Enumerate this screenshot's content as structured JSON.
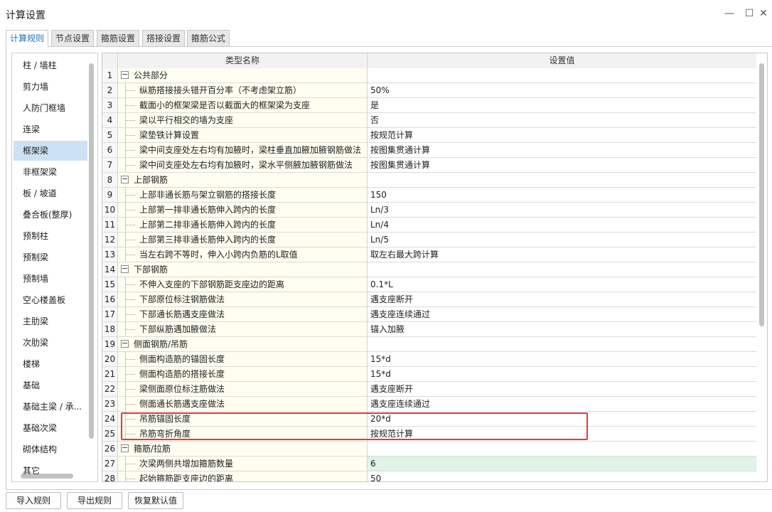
{
  "window": {
    "title": "计算设置",
    "minimize": "—",
    "maximize": "☐",
    "close": "✕"
  },
  "tabs": [
    "计算规则",
    "节点设置",
    "箍筋设置",
    "搭接设置",
    "箍筋公式"
  ],
  "sidebar": {
    "items": [
      "柱 / 墙柱",
      "剪力墙",
      "人防门框墙",
      "连梁",
      "框架梁",
      "非框架梁",
      "板 / 坡道",
      "叠合板(整厚)",
      "预制柱",
      "预制梁",
      "预制墙",
      "空心楼盖板",
      "主肋梁",
      "次肋梁",
      "楼梯",
      "基础",
      "基础主梁 / 承...",
      "基础次梁",
      "砌体结构",
      "其它"
    ],
    "selected_index": 4
  },
  "table": {
    "headers": {
      "name": "类型名称",
      "value": "设置值"
    },
    "rows": [
      {
        "num": "1",
        "group": true,
        "name": "公共部分",
        "value": ""
      },
      {
        "num": "2",
        "name": "纵筋搭接接头错开百分率（不考虑架立筋）",
        "value": "50%"
      },
      {
        "num": "3",
        "name": "截面小的框架梁是否以截面大的框架梁为支座",
        "value": "是"
      },
      {
        "num": "4",
        "name": "梁以平行相交的墙为支座",
        "value": "否"
      },
      {
        "num": "5",
        "name": "梁垫铁计算设置",
        "value": "按规范计算"
      },
      {
        "num": "6",
        "name": "梁中间支座处左右均有加腋时，梁柱垂直加腋加腋钢筋做法",
        "value": "按图集贯通计算"
      },
      {
        "num": "7",
        "name": "梁中间支座处左右均有加腋时，梁水平侧腋加腋钢筋做法",
        "value": "按图集贯通计算"
      },
      {
        "num": "8",
        "group": true,
        "name": "上部钢筋",
        "value": ""
      },
      {
        "num": "9",
        "name": "上部非通长筋与架立钢筋的搭接长度",
        "value": "150"
      },
      {
        "num": "10",
        "name": "上部第一排非通长筋伸入跨内的长度",
        "value": "Ln/3"
      },
      {
        "num": "11",
        "name": "上部第二排非通长筋伸入跨内的长度",
        "value": "Ln/4"
      },
      {
        "num": "12",
        "name": "上部第三排非通长筋伸入跨内的长度",
        "value": "Ln/5"
      },
      {
        "num": "13",
        "name": "当左右跨不等时，伸入小跨内负筋的L取值",
        "value": "取左右最大跨计算"
      },
      {
        "num": "14",
        "group": true,
        "name": "下部钢筋",
        "value": ""
      },
      {
        "num": "15",
        "name": "不伸入支座的下部钢筋距支座边的距离",
        "value": "0.1*L"
      },
      {
        "num": "16",
        "name": "下部原位标注钢筋做法",
        "value": "遇支座断开"
      },
      {
        "num": "17",
        "name": "下部通长筋遇支座做法",
        "value": "遇支座连续通过"
      },
      {
        "num": "18",
        "name": "下部纵筋遇加腋做法",
        "value": "锚入加腋"
      },
      {
        "num": "19",
        "group": true,
        "name": "侧面钢筋/吊筋",
        "value": ""
      },
      {
        "num": "20",
        "name": "侧面构造筋的锚固长度",
        "value": "15*d"
      },
      {
        "num": "21",
        "name": "侧面构造筋的搭接长度",
        "value": "15*d"
      },
      {
        "num": "22",
        "name": "梁侧面原位标注筋做法",
        "value": "遇支座断开"
      },
      {
        "num": "23",
        "name": "侧面通长筋遇支座做法",
        "value": "遇支座连续通过"
      },
      {
        "num": "24",
        "name": "吊筋锚固长度",
        "value": "20*d"
      },
      {
        "num": "25",
        "name": "吊筋弯折角度",
        "value": "按规范计算"
      },
      {
        "num": "26",
        "group": true,
        "name": "箍筋/拉筋",
        "value": ""
      },
      {
        "num": "27",
        "name": "次梁两侧共增加箍筋数量",
        "value": "6",
        "highlight": true
      },
      {
        "num": "28",
        "name": "起始箍筋距支座边的距离",
        "value": "50"
      }
    ]
  },
  "buttons": {
    "import": "导入规则",
    "export": "导出规则",
    "restore": "恢复默认值"
  },
  "colors": {
    "accent": "#1e73be",
    "selected": "#cde1f5",
    "highlight_box": "#e23a3a",
    "edit_cell": "#dff3e8"
  }
}
